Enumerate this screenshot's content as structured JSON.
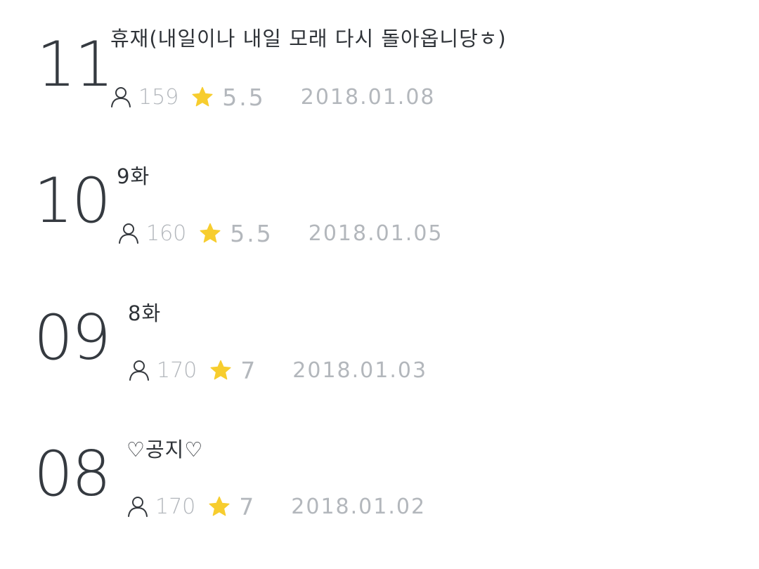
{
  "episodes": [
    {
      "number": "11",
      "title": "휴재(내일이나 내일 모래 다시 돌아옵니당ㅎ)",
      "views": "159",
      "rating": "5.5",
      "date": "2018.01.08"
    },
    {
      "number": "10",
      "title": "9화",
      "views": "160",
      "rating": "5.5",
      "date": "2018.01.05"
    },
    {
      "number": "09",
      "title": "8화",
      "views": "170",
      "rating": "7",
      "date": "2018.01.03"
    },
    {
      "number": "08",
      "title": "♡공지♡",
      "views": "170",
      "rating": "7",
      "date": "2018.01.02"
    }
  ],
  "icons": {
    "views": "user-icon",
    "rating": "star-icon"
  },
  "colors": {
    "number": "#353a40",
    "title": "#2f3338",
    "meta": "#b3b7bc",
    "star": "#f7cd2e"
  }
}
